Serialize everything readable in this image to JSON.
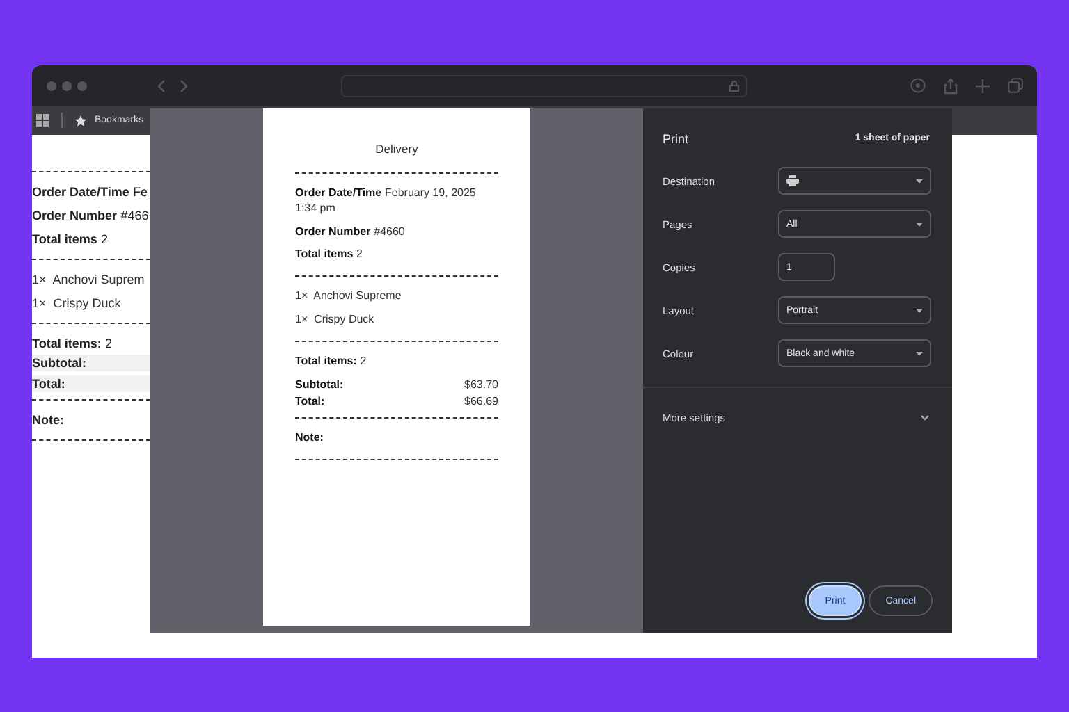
{
  "bookmarks_bar": {
    "label": "Bookmarks"
  },
  "background_page": {
    "sections": [
      [
        {
          "kind": "field",
          "label": "Order Date/Time",
          "value": "Fe"
        },
        {
          "kind": "field",
          "label": "Order Number",
          "value": "#466"
        },
        {
          "kind": "field",
          "label": "Total items",
          "value": "2"
        }
      ],
      [
        {
          "kind": "item",
          "qty": "1×",
          "name": "Anchovi Suprem"
        },
        {
          "kind": "item",
          "qty": "1×",
          "name": "Crispy Duck"
        }
      ],
      [
        {
          "kind": "field",
          "label": "Total items:",
          "value": "2"
        },
        {
          "kind": "amount",
          "label": "Subtotal:"
        },
        {
          "kind": "amount",
          "label": "Total:"
        }
      ],
      [
        {
          "kind": "field",
          "label": "Note:"
        }
      ]
    ]
  },
  "print_preview": {
    "title": "Delivery",
    "sections": [
      [
        {
          "kind": "field",
          "label": "Order Date/Time",
          "value": "February 19, 2025 1:34 pm"
        },
        {
          "kind": "field",
          "label": "Order Number",
          "value": "#4660"
        },
        {
          "kind": "field",
          "label": "Total items",
          "value": "2"
        }
      ],
      [
        {
          "kind": "item",
          "qty": "1×",
          "name": "Anchovi Supreme"
        },
        {
          "kind": "item",
          "qty": "1×",
          "name": "Crispy Duck"
        }
      ],
      [
        {
          "kind": "field",
          "label": "Total items:",
          "value": "2"
        },
        {
          "kind": "amount",
          "label": "Subtotal:",
          "value": "$63.70"
        },
        {
          "kind": "amount",
          "label": "Total:",
          "value": "$66.69"
        }
      ],
      [
        {
          "kind": "field",
          "label": "Note:"
        }
      ]
    ]
  },
  "print_settings": {
    "title": "Print",
    "sheets": "1 sheet of paper",
    "rows": [
      {
        "label": "Destination",
        "kind": "destination"
      },
      {
        "label": "Pages",
        "kind": "select",
        "value": "All"
      },
      {
        "label": "Copies",
        "kind": "number",
        "value": "1"
      },
      {
        "label": "Layout",
        "kind": "select",
        "value": "Portrait"
      },
      {
        "label": "Colour",
        "kind": "select",
        "value": "Black and white"
      }
    ],
    "more_settings": {
      "label": "More settings",
      "expanded": false
    },
    "buttons": [
      {
        "label": "Print",
        "kind": "primary"
      },
      {
        "label": "Cancel",
        "kind": "secondary"
      }
    ]
  }
}
